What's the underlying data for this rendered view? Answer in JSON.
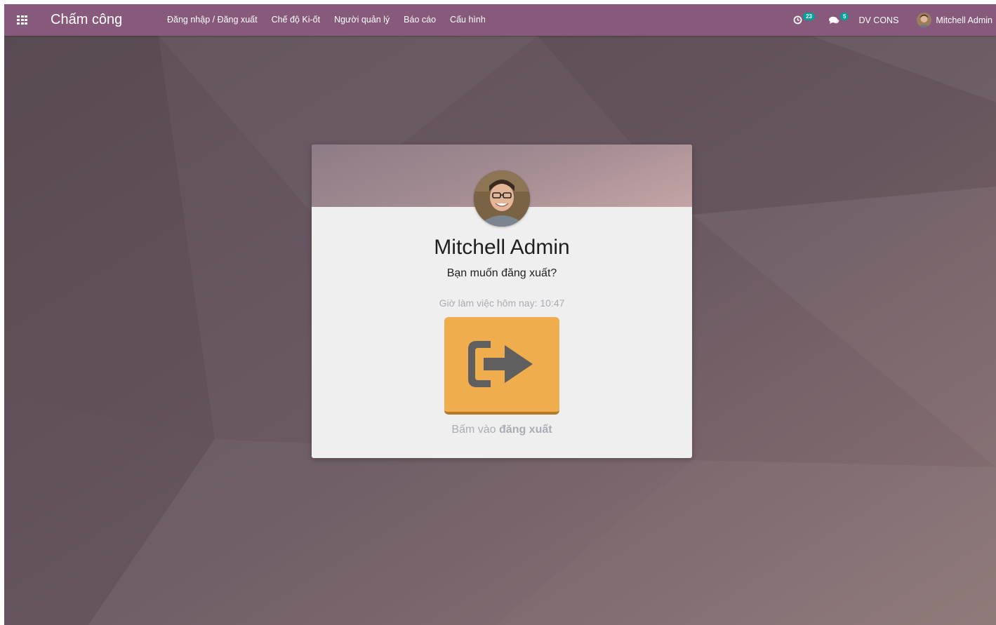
{
  "navbar": {
    "app_title": "Chấm công",
    "menu": [
      {
        "label": "Đăng nhập / Đăng xuất"
      },
      {
        "label": "Chế độ Ki-ốt"
      },
      {
        "label": "Người quản lý"
      },
      {
        "label": "Báo cáo"
      },
      {
        "label": "Cấu hình"
      }
    ],
    "systray": {
      "activity_count": "23",
      "message_count": "5",
      "company": "DV CONS",
      "user_name": "Mitchell Admin"
    }
  },
  "card": {
    "employee_name": "Mitchell Admin",
    "question": "Bạn muốn đăng xuất?",
    "hours_today": "Giờ làm việc hôm nay: 10:47",
    "hint_prefix": "Bấm vào ",
    "hint_action": "đăng xuất"
  },
  "colors": {
    "navbar": "#875a7b",
    "badge": "#00a09d",
    "sign_button": "#f0ad4e",
    "sign_icon": "#5f5f5f"
  },
  "icons": {
    "apps": "apps-grid-icon",
    "activity": "clock-icon",
    "messages": "comments-icon",
    "sign_out": "sign-out-icon"
  }
}
